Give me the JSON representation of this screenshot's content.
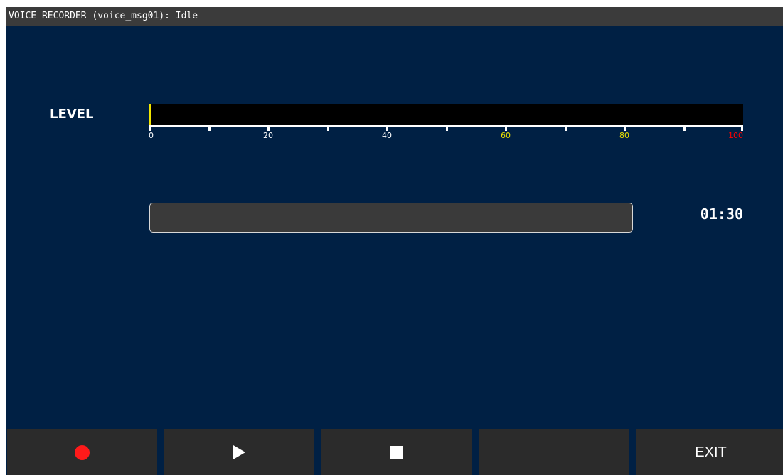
{
  "window": {
    "title": "VOICE RECORDER (voice_msg01): Idle"
  },
  "colors": {
    "background": "#002044",
    "titlebar": "#3b3b3b",
    "meter_background": "#000000",
    "meter_cursor": "#f2e600",
    "scale_normal": "#ffffff",
    "scale_warning": "#e8e000",
    "scale_peak": "#ff0000",
    "record_icon": "#ff1a1a",
    "button_background": "#2b2b2b"
  },
  "level_meter": {
    "label": "LEVEL",
    "value": 0,
    "scale": {
      "min": 0,
      "max": 100,
      "minor_ticks": [
        10,
        30,
        50,
        70,
        90
      ],
      "labels": [
        {
          "text": "0",
          "value": 0,
          "zone": "normal"
        },
        {
          "text": "20",
          "value": 20,
          "zone": "normal"
        },
        {
          "text": "40",
          "value": 40,
          "zone": "normal"
        },
        {
          "text": "60",
          "value": 60,
          "zone": "warning"
        },
        {
          "text": "80",
          "value": 80,
          "zone": "warning"
        },
        {
          "text": "100",
          "value": 100,
          "zone": "peak"
        }
      ]
    }
  },
  "progress": {
    "fraction": 0,
    "time": "01:30"
  },
  "buttons": [
    {
      "name": "record-button",
      "icon": "record-icon",
      "label": ""
    },
    {
      "name": "play-button",
      "icon": "play-icon",
      "label": ""
    },
    {
      "name": "stop-button",
      "icon": "stop-icon",
      "label": ""
    },
    {
      "name": "blank-button",
      "icon": "",
      "label": ""
    },
    {
      "name": "exit-button",
      "icon": "",
      "label": "EXIT"
    }
  ]
}
